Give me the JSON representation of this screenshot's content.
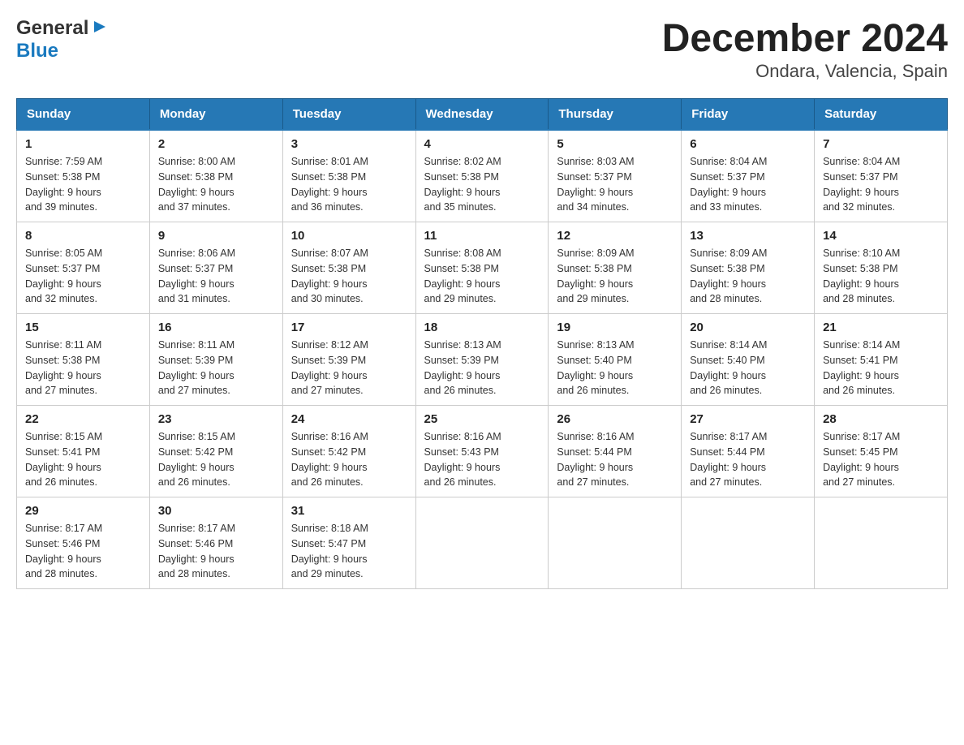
{
  "header": {
    "title": "December 2024",
    "subtitle": "Ondara, Valencia, Spain"
  },
  "logo": {
    "part1": "General",
    "part2": "Blue"
  },
  "days_of_week": [
    "Sunday",
    "Monday",
    "Tuesday",
    "Wednesday",
    "Thursday",
    "Friday",
    "Saturday"
  ],
  "weeks": [
    [
      {
        "day": "1",
        "sunrise": "7:59 AM",
        "sunset": "5:38 PM",
        "daylight": "9 hours and 39 minutes."
      },
      {
        "day": "2",
        "sunrise": "8:00 AM",
        "sunset": "5:38 PM",
        "daylight": "9 hours and 37 minutes."
      },
      {
        "day": "3",
        "sunrise": "8:01 AM",
        "sunset": "5:38 PM",
        "daylight": "9 hours and 36 minutes."
      },
      {
        "day": "4",
        "sunrise": "8:02 AM",
        "sunset": "5:38 PM",
        "daylight": "9 hours and 35 minutes."
      },
      {
        "day": "5",
        "sunrise": "8:03 AM",
        "sunset": "5:37 PM",
        "daylight": "9 hours and 34 minutes."
      },
      {
        "day": "6",
        "sunrise": "8:04 AM",
        "sunset": "5:37 PM",
        "daylight": "9 hours and 33 minutes."
      },
      {
        "day": "7",
        "sunrise": "8:04 AM",
        "sunset": "5:37 PM",
        "daylight": "9 hours and 32 minutes."
      }
    ],
    [
      {
        "day": "8",
        "sunrise": "8:05 AM",
        "sunset": "5:37 PM",
        "daylight": "9 hours and 32 minutes."
      },
      {
        "day": "9",
        "sunrise": "8:06 AM",
        "sunset": "5:37 PM",
        "daylight": "9 hours and 31 minutes."
      },
      {
        "day": "10",
        "sunrise": "8:07 AM",
        "sunset": "5:38 PM",
        "daylight": "9 hours and 30 minutes."
      },
      {
        "day": "11",
        "sunrise": "8:08 AM",
        "sunset": "5:38 PM",
        "daylight": "9 hours and 29 minutes."
      },
      {
        "day": "12",
        "sunrise": "8:09 AM",
        "sunset": "5:38 PM",
        "daylight": "9 hours and 29 minutes."
      },
      {
        "day": "13",
        "sunrise": "8:09 AM",
        "sunset": "5:38 PM",
        "daylight": "9 hours and 28 minutes."
      },
      {
        "day": "14",
        "sunrise": "8:10 AM",
        "sunset": "5:38 PM",
        "daylight": "9 hours and 28 minutes."
      }
    ],
    [
      {
        "day": "15",
        "sunrise": "8:11 AM",
        "sunset": "5:38 PM",
        "daylight": "9 hours and 27 minutes."
      },
      {
        "day": "16",
        "sunrise": "8:11 AM",
        "sunset": "5:39 PM",
        "daylight": "9 hours and 27 minutes."
      },
      {
        "day": "17",
        "sunrise": "8:12 AM",
        "sunset": "5:39 PM",
        "daylight": "9 hours and 27 minutes."
      },
      {
        "day": "18",
        "sunrise": "8:13 AM",
        "sunset": "5:39 PM",
        "daylight": "9 hours and 26 minutes."
      },
      {
        "day": "19",
        "sunrise": "8:13 AM",
        "sunset": "5:40 PM",
        "daylight": "9 hours and 26 minutes."
      },
      {
        "day": "20",
        "sunrise": "8:14 AM",
        "sunset": "5:40 PM",
        "daylight": "9 hours and 26 minutes."
      },
      {
        "day": "21",
        "sunrise": "8:14 AM",
        "sunset": "5:41 PM",
        "daylight": "9 hours and 26 minutes."
      }
    ],
    [
      {
        "day": "22",
        "sunrise": "8:15 AM",
        "sunset": "5:41 PM",
        "daylight": "9 hours and 26 minutes."
      },
      {
        "day": "23",
        "sunrise": "8:15 AM",
        "sunset": "5:42 PM",
        "daylight": "9 hours and 26 minutes."
      },
      {
        "day": "24",
        "sunrise": "8:16 AM",
        "sunset": "5:42 PM",
        "daylight": "9 hours and 26 minutes."
      },
      {
        "day": "25",
        "sunrise": "8:16 AM",
        "sunset": "5:43 PM",
        "daylight": "9 hours and 26 minutes."
      },
      {
        "day": "26",
        "sunrise": "8:16 AM",
        "sunset": "5:44 PM",
        "daylight": "9 hours and 27 minutes."
      },
      {
        "day": "27",
        "sunrise": "8:17 AM",
        "sunset": "5:44 PM",
        "daylight": "9 hours and 27 minutes."
      },
      {
        "day": "28",
        "sunrise": "8:17 AM",
        "sunset": "5:45 PM",
        "daylight": "9 hours and 27 minutes."
      }
    ],
    [
      {
        "day": "29",
        "sunrise": "8:17 AM",
        "sunset": "5:46 PM",
        "daylight": "9 hours and 28 minutes."
      },
      {
        "day": "30",
        "sunrise": "8:17 AM",
        "sunset": "5:46 PM",
        "daylight": "9 hours and 28 minutes."
      },
      {
        "day": "31",
        "sunrise": "8:18 AM",
        "sunset": "5:47 PM",
        "daylight": "9 hours and 29 minutes."
      },
      null,
      null,
      null,
      null
    ]
  ],
  "labels": {
    "sunrise": "Sunrise:",
    "sunset": "Sunset:",
    "daylight": "Daylight:"
  }
}
